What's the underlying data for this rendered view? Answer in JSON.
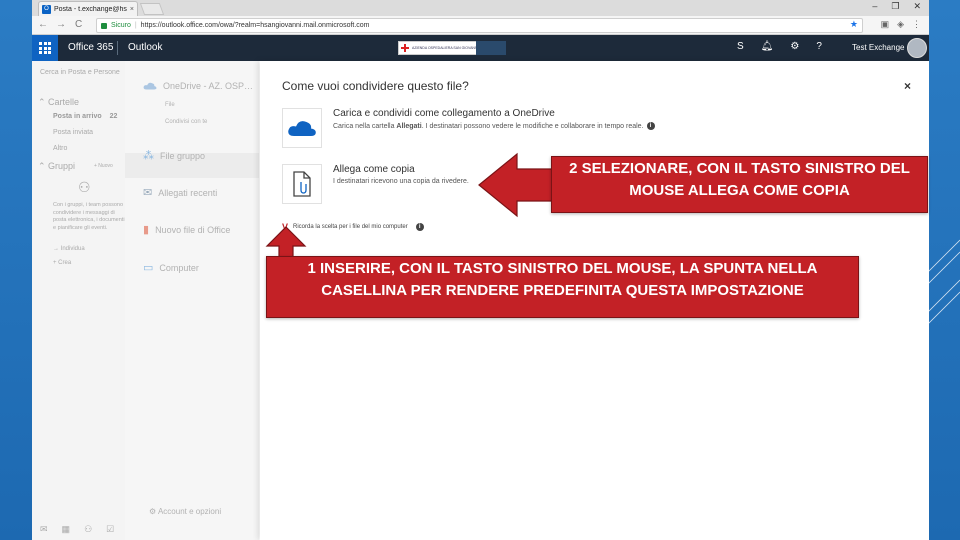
{
  "browser": {
    "tab_title": "Posta - t.exchange@hsan",
    "tab_close": "×",
    "window_controls": [
      "–",
      "❐",
      "✕"
    ],
    "secure_label": "Sicuro",
    "url": "https://outlook.office.com/owa/?realm=hsangiovanni.mail.onmicrosoft.com",
    "nav": {
      "back": "←",
      "forward": "→",
      "reload": "C"
    }
  },
  "o365": {
    "brand": "Office 365",
    "app": "Outlook",
    "user_name": "Test Exchange",
    "logo_text": "AZIENDA OSPEDALIERA SAN GIOVANNI ADDOLORATA",
    "help_icon": "?"
  },
  "left_pane": {
    "search_placeholder": "Cerca in Posta e Persone",
    "folders_header": "Cartelle",
    "items": [
      {
        "label": "Posta in arrivo",
        "count": "22"
      },
      {
        "label": "Posta inviata"
      },
      {
        "label": "Altro"
      }
    ],
    "groups_header": "Gruppi",
    "groups_new": "+ Nuovo",
    "groups_desc": "Con i gruppi, i team possono condividere i messaggi di posta elettronica, i documenti e pianificare gli eventi.",
    "explore": "Individua",
    "create": "Crea"
  },
  "source_pane": {
    "items": [
      {
        "label": "OneDrive - AZ. OSP…",
        "subs": [
          "File",
          "Condivisi con te"
        ]
      },
      {
        "label": "File gruppo"
      },
      {
        "label": "Allegati recenti"
      },
      {
        "label": "Nuovo file di Office"
      },
      {
        "label": "Computer"
      }
    ],
    "account": "Account e opzioni"
  },
  "dialog": {
    "title": "Come vuoi condividere questo file?",
    "close": "×",
    "option_onedrive": {
      "title": "Carica e condividi come collegamento a OneDrive",
      "desc_prefix": "Carica nella cartella ",
      "desc_bold": "Allegati",
      "desc_suffix": ". I destinatari possono vedere le modifiche e collaborare in tempo reale."
    },
    "option_copy": {
      "title": "Allega come copia",
      "desc": "I destinatari ricevono una copia da rivedere."
    },
    "remember_label": "Ricorda la scelta per i file del mio computer",
    "check_symbol": "V"
  },
  "callouts": {
    "step2": "2 SELEZIONARE, CON IL TASTO SINISTRO DEL MOUSE ALLEGA COME COPIA",
    "step1": "1 INSERIRE, CON IL TASTO SINISTRO DEL MOUSE, LA SPUNTA NELLA CASELLINA PER RENDERE PREDEFINITA QUESTA IMPOSTAZIONE",
    "color": "#c32126"
  }
}
